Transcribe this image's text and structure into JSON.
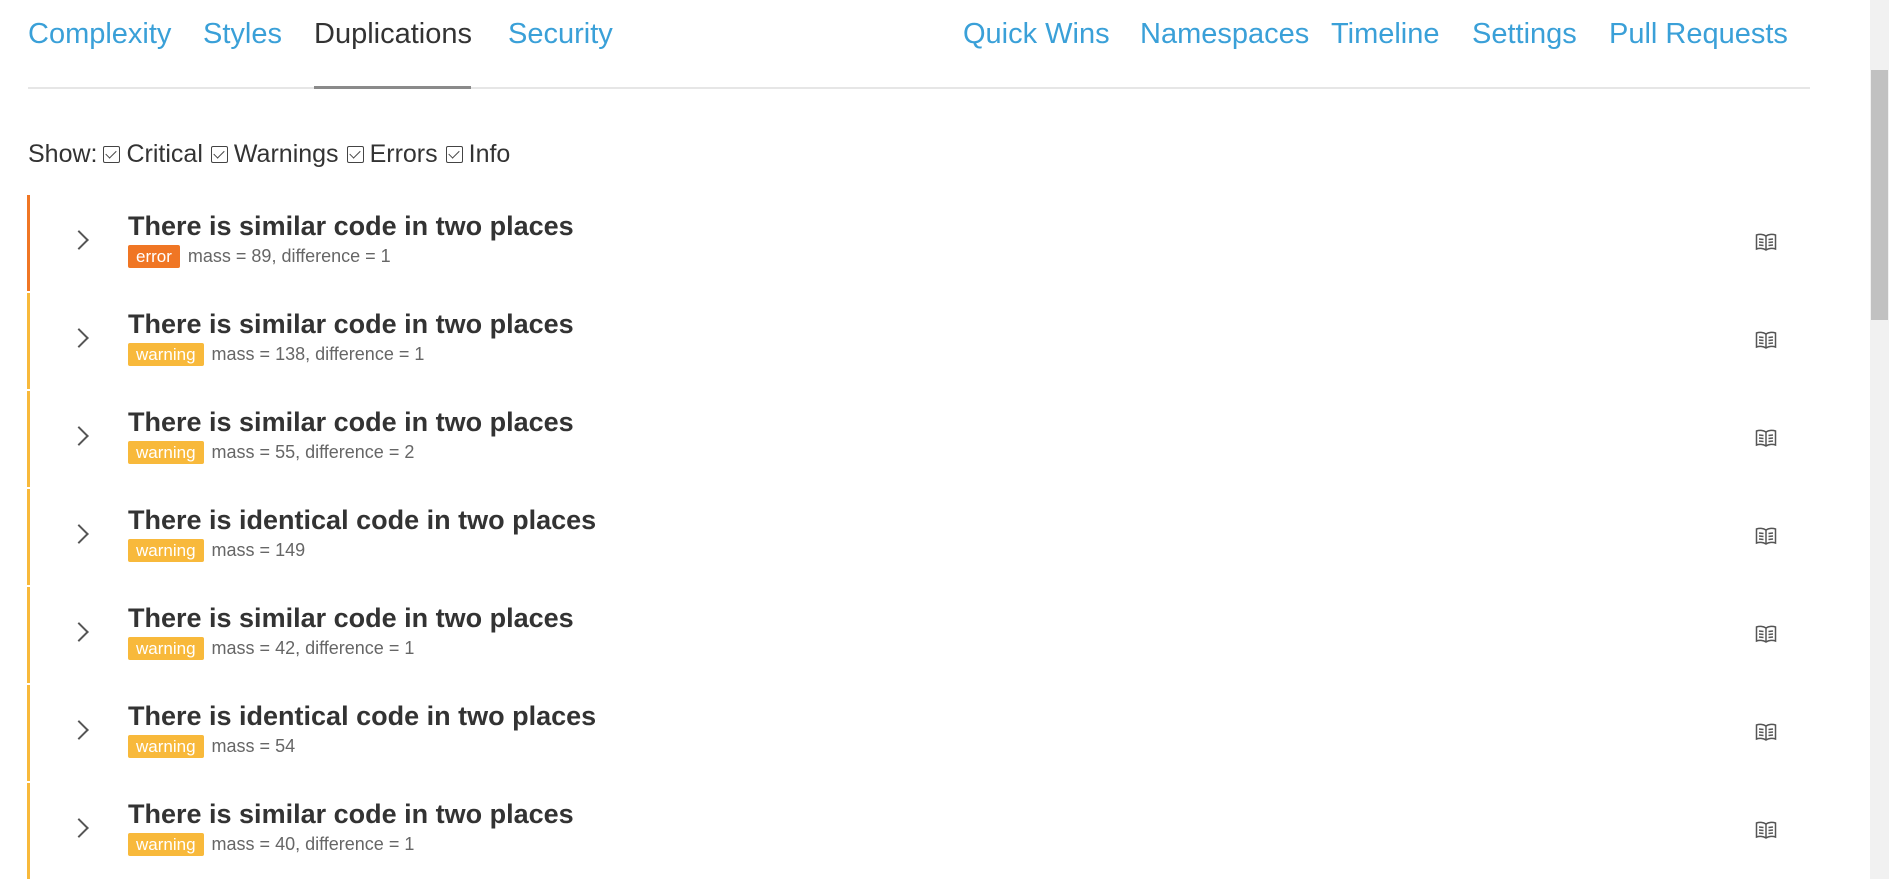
{
  "tabs": {
    "left": [
      "Complexity",
      "Styles",
      "Duplications",
      "Security"
    ],
    "right": [
      "Quick Wins",
      "Namespaces",
      "Timeline",
      "Settings",
      "Pull Requests"
    ],
    "active": "Duplications"
  },
  "filter": {
    "label": "Show:",
    "options": [
      {
        "label": "Critical",
        "checked": true
      },
      {
        "label": "Warnings",
        "checked": true
      },
      {
        "label": "Errors",
        "checked": true
      },
      {
        "label": "Info",
        "checked": true
      }
    ]
  },
  "issues": [
    {
      "title": "There is similar code in two places",
      "severity": "error",
      "meta": "mass = 89, difference = 1"
    },
    {
      "title": "There is similar code in two places",
      "severity": "warning",
      "meta": "mass = 138, difference = 1"
    },
    {
      "title": "There is similar code in two places",
      "severity": "warning",
      "meta": "mass = 55, difference = 2"
    },
    {
      "title": "There is identical code in two places",
      "severity": "warning",
      "meta": "mass = 149"
    },
    {
      "title": "There is similar code in two places",
      "severity": "warning",
      "meta": "mass = 42, difference = 1"
    },
    {
      "title": "There is identical code in two places",
      "severity": "warning",
      "meta": "mass = 54"
    },
    {
      "title": "There is similar code in two places",
      "severity": "warning",
      "meta": "mass = 40, difference = 1"
    }
  ],
  "icons": {
    "expand": "chevron-right-icon",
    "docs": "book-icon"
  },
  "colors": {
    "link": "#3aa0d8",
    "error": "#f07624",
    "warning": "#f8b93b",
    "text": "#333333"
  }
}
